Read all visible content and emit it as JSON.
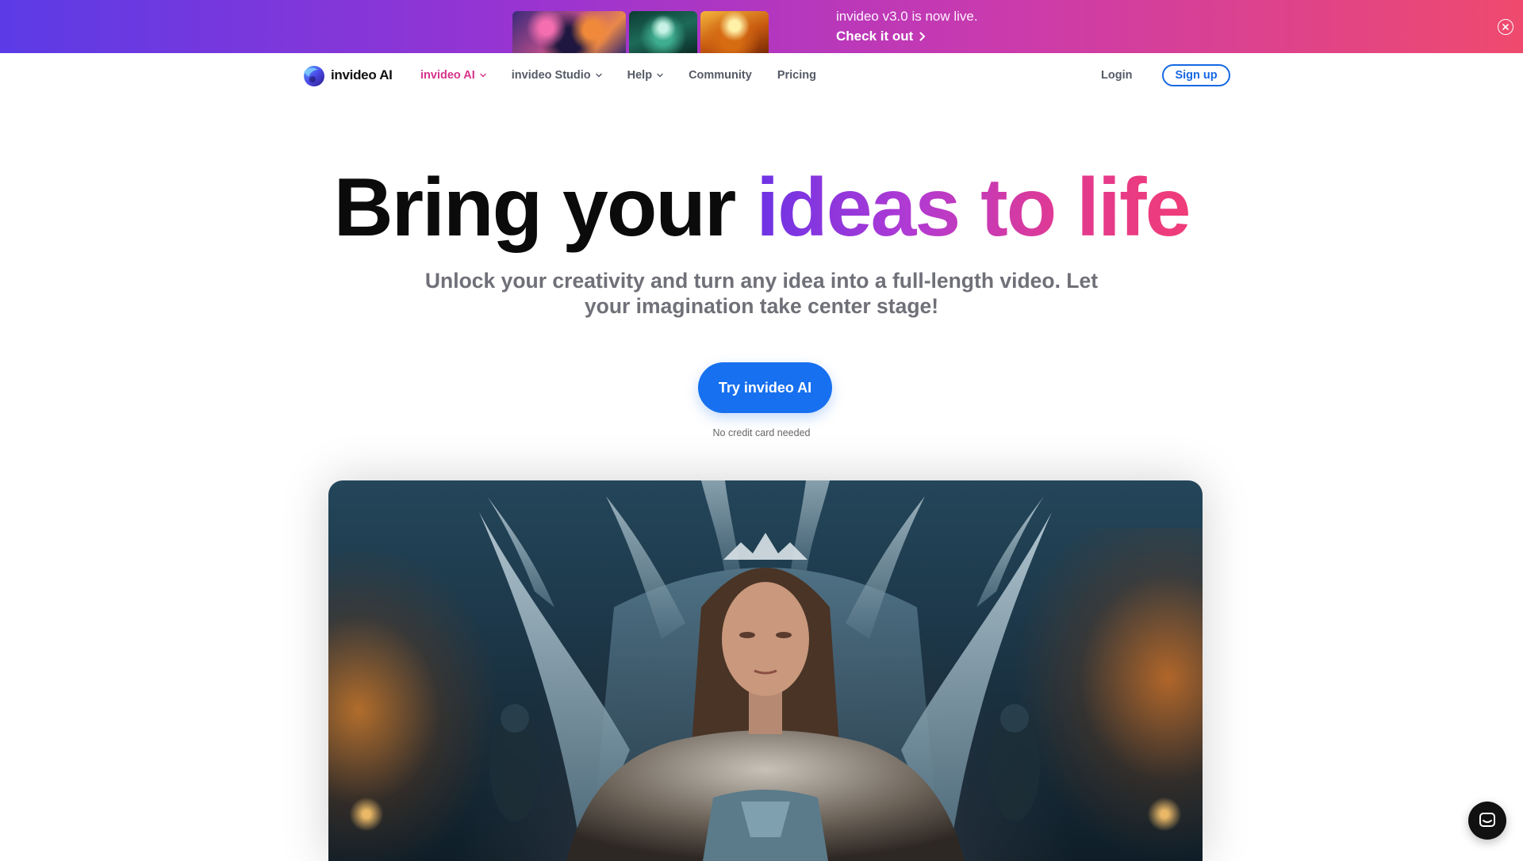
{
  "banner": {
    "headline": "invideo v3.0 is now live.",
    "cta": "Check it out",
    "thumbnails": [
      "cosmic-thumbnail",
      "green-creature-thumbnail",
      "fire-figure-thumbnail"
    ]
  },
  "nav": {
    "logo_text": "invideo AI",
    "links": [
      {
        "label": "invideo AI",
        "has_dropdown": true,
        "active": true
      },
      {
        "label": "invideo Studio",
        "has_dropdown": true,
        "active": false
      },
      {
        "label": "Help",
        "has_dropdown": true,
        "active": false
      },
      {
        "label": "Community",
        "has_dropdown": false,
        "active": false
      },
      {
        "label": "Pricing",
        "has_dropdown": false,
        "active": false
      }
    ],
    "login": "Login",
    "signup": "Sign up"
  },
  "hero": {
    "title_plain": "Bring your ",
    "title_gradient": "ideas to life",
    "subtitle": "Unlock your creativity and turn any idea into a full-length video. Let your imagination take center stage!",
    "cta": "Try invideo AI",
    "note": "No credit card needed"
  },
  "colors": {
    "brand_blue": "#1670ef",
    "active_pink": "#d6338a",
    "banner_start": "#5b3be6",
    "banner_end": "#ef4a6e"
  },
  "icons": {
    "close": "close-circle-icon",
    "chevron": "chevron-down-icon",
    "arrow": "chevron-right-icon",
    "chat": "chat-icon"
  }
}
